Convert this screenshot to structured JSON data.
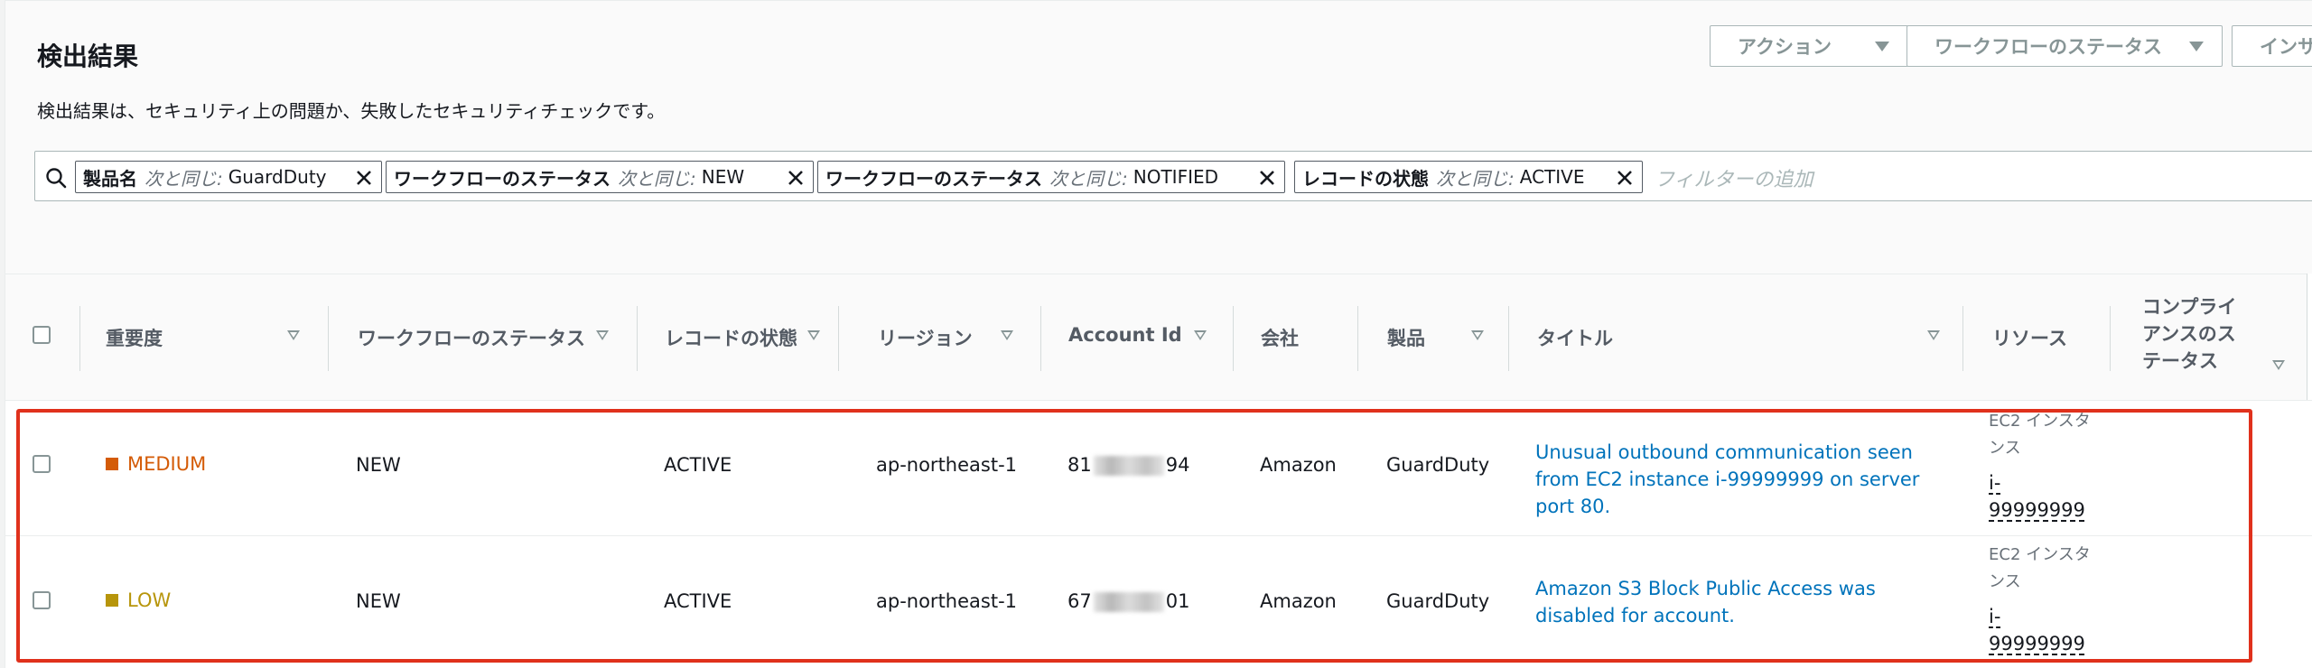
{
  "page": {
    "title": "検出結果",
    "description": "検出結果は、セキュリティ上の問題か、失敗したセキュリティチェックです。"
  },
  "toolbar": {
    "actions_label": "アクション",
    "workflow_status_label": "ワークフローのステータス",
    "insights_label": "インサ"
  },
  "filters": {
    "tokens": [
      {
        "key": "製品名",
        "op": "次と同じ:",
        "value": "GuardDuty"
      },
      {
        "key": "ワークフローのステータス",
        "op": "次と同じ:",
        "value": "NEW"
      },
      {
        "key": "ワークフローのステータス",
        "op": "次と同じ:",
        "value": "NOTIFIED"
      },
      {
        "key": "レコードの状態",
        "op": "次と同じ:",
        "value": "ACTIVE"
      }
    ],
    "placeholder": "フィルターの追加"
  },
  "table": {
    "columns": [
      {
        "label": "重要度"
      },
      {
        "label": "ワークフローのステータス"
      },
      {
        "label": "レコードの状態"
      },
      {
        "label": "リージョン"
      },
      {
        "label": "Account Id"
      },
      {
        "label": "会社"
      },
      {
        "label": "製品"
      },
      {
        "label": "タイトル"
      },
      {
        "label": "リソース"
      },
      {
        "label_lines": [
          "コンプライ",
          "アンスのス",
          "テータス"
        ]
      }
    ],
    "rows": [
      {
        "severity": "MEDIUM",
        "severity_color": "#d45b07",
        "workflow_status": "NEW",
        "record_state": "ACTIVE",
        "region": "ap-northeast-1",
        "account_prefix": "81",
        "account_suffix": "94",
        "company": "Amazon",
        "product": "GuardDuty",
        "title": "Unusual outbound communication seen from EC2 instance i-99999999 on server port 80.",
        "resource_type": "EC2 インスタンス",
        "resource_id": "i-99999999"
      },
      {
        "severity": "LOW",
        "severity_color": "#b7950b",
        "workflow_status": "NEW",
        "record_state": "ACTIVE",
        "region": "ap-northeast-1",
        "account_prefix": "67",
        "account_suffix": "01",
        "company": "Amazon",
        "product": "GuardDuty",
        "title": "Amazon S3 Block Public Access was disabled for account.",
        "resource_type": "EC2 インスタンス",
        "resource_id": "i-99999999"
      }
    ]
  }
}
